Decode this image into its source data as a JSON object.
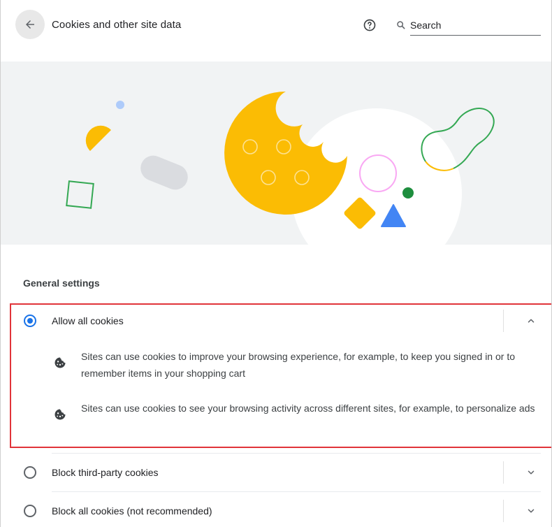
{
  "header": {
    "title": "Cookies and other site data",
    "back_icon": "arrow-back-icon",
    "help_icon": "help-circle-icon",
    "search": {
      "placeholder": "Search",
      "value": "",
      "icon": "search-icon"
    }
  },
  "banner": {
    "illustration": "cookie-illustration"
  },
  "section": {
    "heading": "General settings"
  },
  "options": [
    {
      "label": "Allow all cookies",
      "selected": true,
      "expanded": true,
      "expand_icon": "chevron-up-icon",
      "descriptions": [
        {
          "icon": "cookie-icon",
          "text": "Sites can use cookies to improve your browsing experience, for example, to keep you signed in or to remember items in your shopping cart"
        },
        {
          "icon": "cookie-icon",
          "text": "Sites can use cookies to see your browsing activity across different sites, for example, to personalize ads"
        }
      ]
    },
    {
      "label": "Block third-party cookies",
      "selected": false,
      "expanded": false,
      "expand_icon": "chevron-down-icon"
    },
    {
      "label": "Block all cookies (not recommended)",
      "selected": false,
      "expanded": false,
      "expand_icon": "chevron-down-icon"
    }
  ],
  "colors": {
    "accent": "#1a73e8",
    "highlight_border": "#e1343a",
    "banner_bg": "#f1f3f4",
    "cookie_yellow": "#fbbc04",
    "google_green": "#1e8e3e",
    "google_blue": "#4285f4"
  }
}
